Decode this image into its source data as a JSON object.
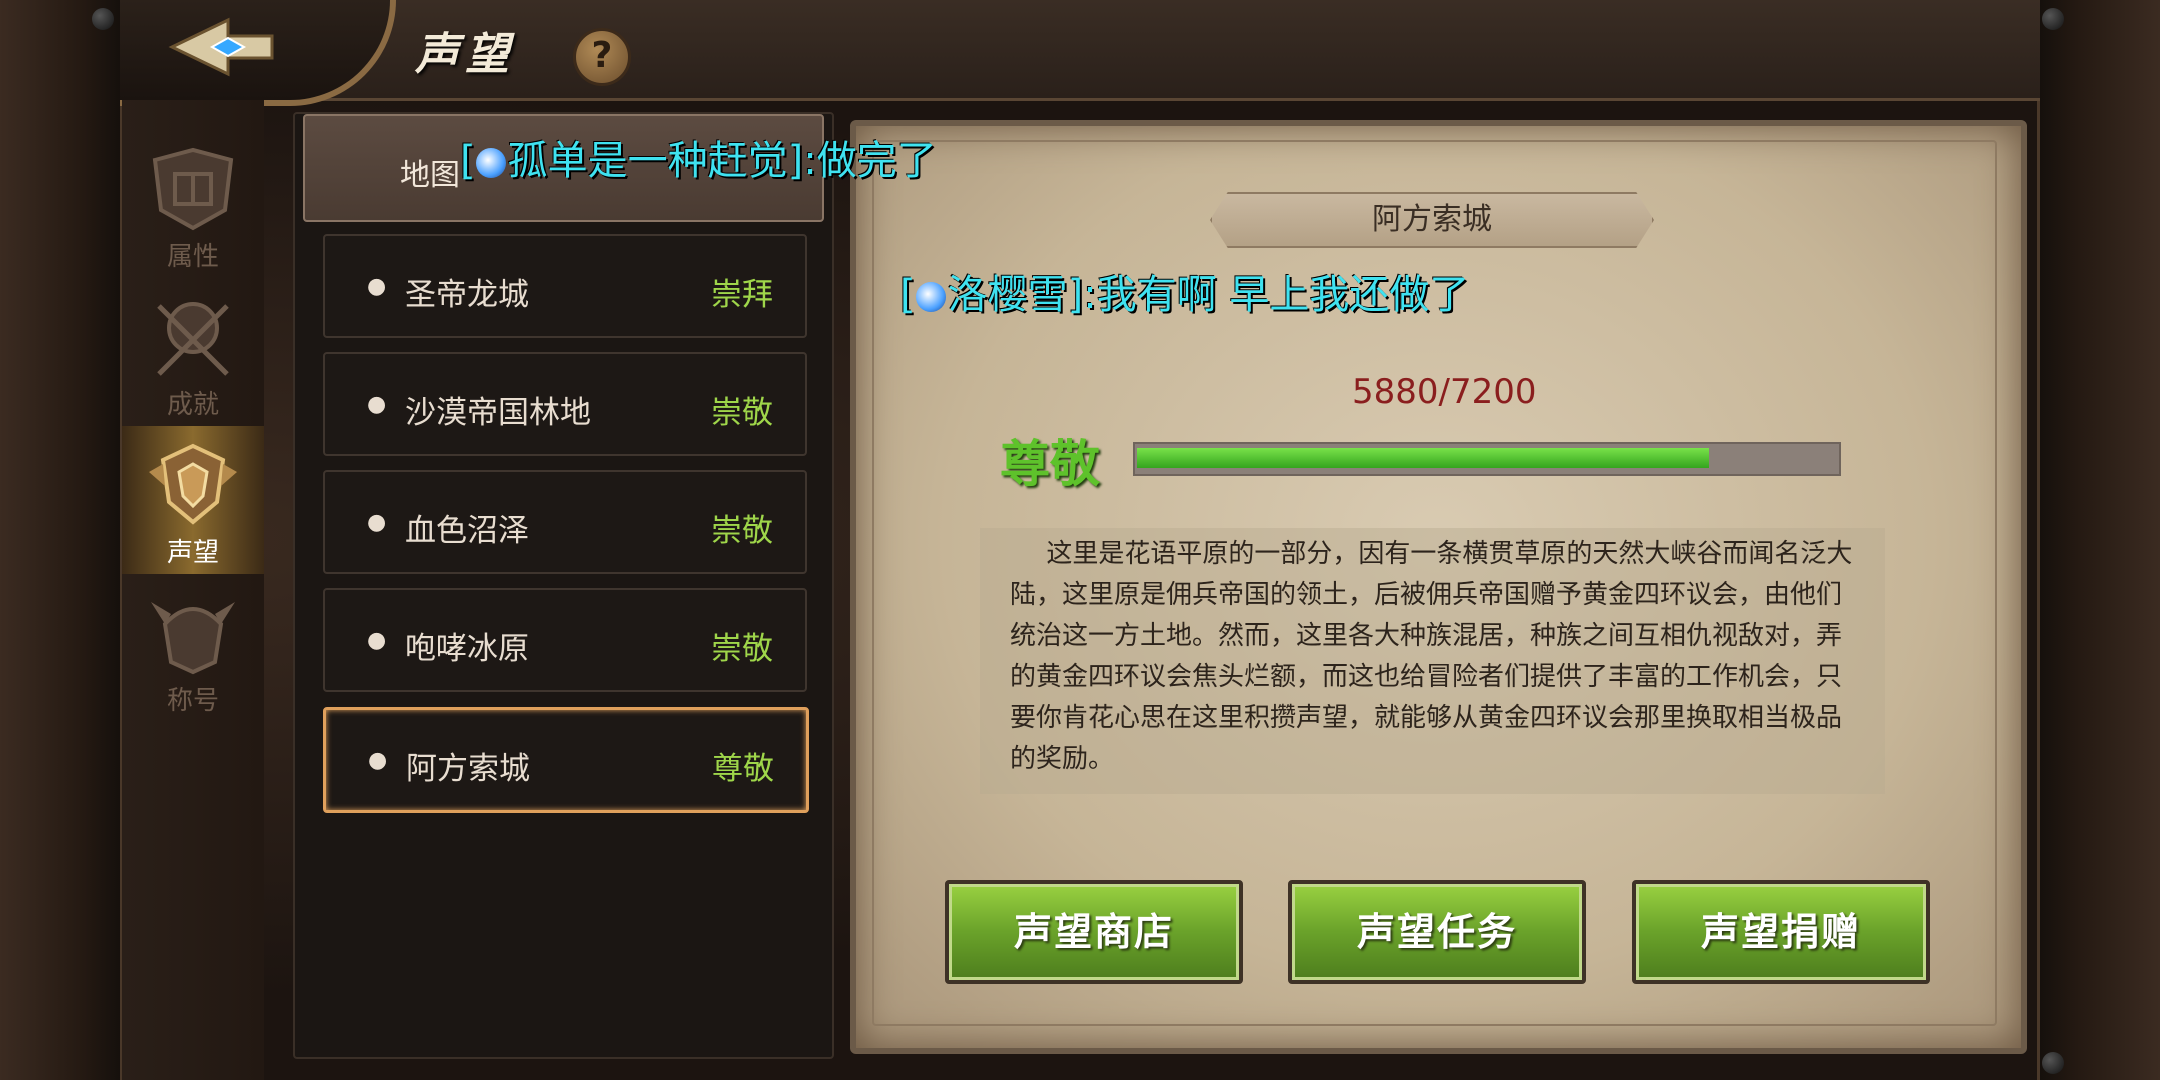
{
  "header": {
    "title": "声望",
    "help_label": "?"
  },
  "nav": {
    "items": [
      {
        "label": "属性",
        "active": false
      },
      {
        "label": "成就",
        "active": false
      },
      {
        "label": "声望",
        "active": true
      },
      {
        "label": "称号",
        "active": false
      }
    ]
  },
  "list": {
    "header": "地图",
    "rows": [
      {
        "name": "圣帝龙城",
        "rank": "崇拜",
        "selected": false
      },
      {
        "name": "沙漠帝国林地",
        "rank": "崇敬",
        "selected": false
      },
      {
        "name": "血色沼泽",
        "rank": "崇敬",
        "selected": false
      },
      {
        "name": "咆哮冰原",
        "rank": "崇敬",
        "selected": false
      },
      {
        "name": "阿方索城",
        "rank": "尊敬",
        "selected": true
      }
    ]
  },
  "detail": {
    "city_name": "阿方索城",
    "reputation_text": "5880/7200",
    "reputation_fraction": 0.8167,
    "rank": "尊敬",
    "description": "这里是花语平原的一部分，因有一条横贯草原的天然大峡谷而闻名泛大陆，这里原是佣兵帝国的领土，后被佣兵帝国赠予黄金四环议会，由他们统治这一方土地。然而，这里各大种族混居，种族之间互相仇视敌对，弄的黄金四环议会焦头烂额，而这也给冒险者们提供了丰富的工作机会，只要你肯花心思在这里积攒声望，就能够从黄金四环议会那里换取相当极品的奖励。",
    "buttons": [
      "声望商店",
      "声望任务",
      "声望捐赠"
    ]
  },
  "chat": [
    {
      "text": "[",
      "name_text": "孤单是一种赶觉]:做完了"
    },
    {
      "text": "[",
      "name_text": "洛樱雪]:我有啊  早上我还做了"
    }
  ],
  "colors": {
    "rank_green": "#9fd64a",
    "reputation_red": "#8a1e1e",
    "chat_cyan": "#3fe2f0",
    "selected_border": "#e0a05c"
  }
}
